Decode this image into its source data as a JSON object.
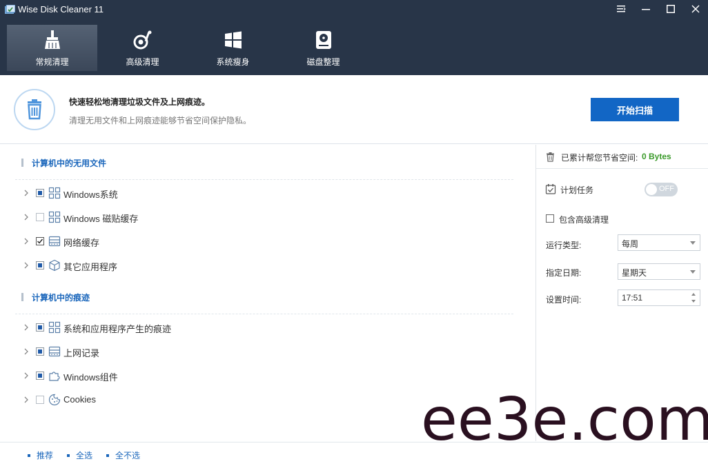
{
  "window": {
    "title": "Wise Disk Cleaner 11"
  },
  "tabs": [
    {
      "label": "常规清理",
      "icon": "broom-icon"
    },
    {
      "label": "高级清理",
      "icon": "advanced-clean-icon"
    },
    {
      "label": "系统瘦身",
      "icon": "windows-icon"
    },
    {
      "label": "磁盘整理",
      "icon": "disk-defrag-icon"
    }
  ],
  "banner": {
    "title": "快速轻松地清理垃圾文件及上网痕迹。",
    "subtitle": "清理无用文件和上网痕迹能够节省空间保护隐私。",
    "scan_button": "开始扫描"
  },
  "sections": [
    {
      "title": "计算机中的无用文件",
      "items": [
        {
          "label": "Windows系统",
          "check": "partial",
          "icon": "windows-tiles-icon"
        },
        {
          "label": "Windows 磁贴缓存",
          "check": "none",
          "icon": "windows-tiles-icon"
        },
        {
          "label": "网络缓存",
          "check": "checked",
          "icon": "network-cache-icon"
        },
        {
          "label": "其它应用程序",
          "check": "partial",
          "icon": "package-icon"
        }
      ]
    },
    {
      "title": "计算机中的痕迹",
      "items": [
        {
          "label": "系统和应用程序产生的痕迹",
          "check": "partial",
          "icon": "windows-tiles-icon"
        },
        {
          "label": "上网记录",
          "check": "partial",
          "icon": "browser-history-icon"
        },
        {
          "label": "Windows组件",
          "check": "partial",
          "icon": "puzzle-icon"
        },
        {
          "label": "Cookies",
          "check": "none",
          "icon": "cookie-icon"
        }
      ]
    }
  ],
  "right_panel": {
    "saved_label": "已累计帮您节省空间:",
    "saved_value": "0 Bytes",
    "schedule_label": "计划任务",
    "toggle_text": "OFF",
    "include_advanced": "包含高级清理",
    "run_type_label": "运行类型:",
    "run_type_value": "每周",
    "date_label": "指定日期:",
    "date_value": "星期天",
    "time_label": "设置时间:",
    "time_value": "17:51"
  },
  "footer": {
    "recommend": "推荐",
    "select_all": "全选",
    "select_none": "全不选"
  },
  "watermark": "ee3e.com",
  "colors": {
    "header_bg": "#283548",
    "accent": "#1266c5",
    "section_title": "#1a66bb",
    "saved_value": "#3a9a2a"
  }
}
